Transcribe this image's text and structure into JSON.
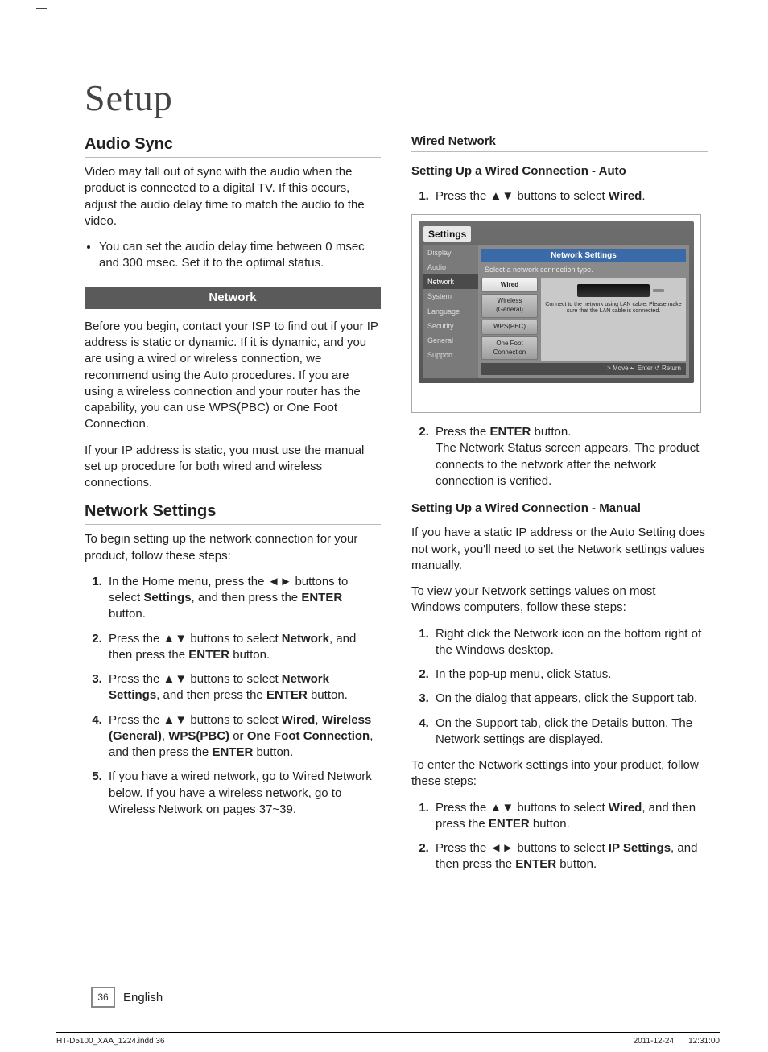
{
  "page_title": "Setup",
  "left": {
    "audio_sync": {
      "heading": "Audio Sync",
      "para": "Video may fall out of sync with the audio when the product is connected to a digital TV. If this occurs, adjust the audio delay time to match the audio to the video.",
      "bullet": "You can set the audio delay time between 0 msec and 300 msec. Set it to the optimal status."
    },
    "network_band": "Network",
    "network_intro1": "Before you begin, contact your ISP to find out if your IP address is static or dynamic. If it is dynamic, and you are using a wired or wireless connection, we recommend using the Auto procedures. If you are using a wireless connection and your router has the capability, you can use WPS(PBC) or One Foot Connection.",
    "network_intro2": "If your IP address is static, you must use the manual set up procedure for both wired and wireless connections.",
    "network_settings": {
      "heading": "Network Settings",
      "lead": "To begin setting up the network connection for your product, follow these steps:",
      "step1_a": "In the Home menu, press the ◄► buttons to select ",
      "step1_b1": "Settings",
      "step1_c": ", and then press the ",
      "step1_b2": "ENTER",
      "step1_d": " button.",
      "step2_a": "Press the ▲▼ buttons to select ",
      "step2_b1": "Network",
      "step2_c": ", and then press the ",
      "step2_b2": "ENTER",
      "step2_d": " button.",
      "step3_a": "Press the ▲▼ buttons to select ",
      "step3_b1": "Network Settings",
      "step3_c": ", and then press the ",
      "step3_b2": "ENTER",
      "step3_d": " button.",
      "step4_a": "Press the ▲▼ buttons to select ",
      "step4_b1": "Wired",
      "step4_s1": ", ",
      "step4_b2": "Wireless (General)",
      "step4_s2": ", ",
      "step4_b3": "WPS(PBC)",
      "step4_s3": " or ",
      "step4_b4": "One Foot Connection",
      "step4_c": ", and then press the ",
      "step4_b5": "ENTER",
      "step4_d": " button.",
      "step5": "If you have a wired network, go to Wired Network below. If you have a wireless network, go to Wireless Network on pages 37~39."
    }
  },
  "right": {
    "wired_heading": "Wired Network",
    "auto": {
      "sub": "Setting Up a Wired Connection - Auto",
      "step1_a": "Press the ▲▼ buttons to select ",
      "step1_b": "Wired",
      "step1_c": ".",
      "step2_a": "Press the ",
      "step2_b": "ENTER",
      "step2_c": " button.",
      "step2_p": "The Network Status screen appears. The product connects to the network after the network connection is verified."
    },
    "manual": {
      "sub": "Setting Up a Wired Connection - Manual",
      "p1": "If you have a static IP address or the Auto Setting does not work, you'll need to set the Network settings values manually.",
      "p2": "To view your Network settings values on most Windows computers, follow these steps:",
      "w1": "Right click the Network icon on the bottom right of the Windows desktop.",
      "w2": "In the pop-up menu, click Status.",
      "w3": "On the dialog that appears, click the Support tab.",
      "w4": "On the Support tab, click the Details button. The Network settings are displayed.",
      "p3": "To enter the Network settings into your product, follow these steps:",
      "s1_a": "Press the ▲▼ buttons to select ",
      "s1_b": "Wired",
      "s1_c": ", and then press the ",
      "s1_d": "ENTER",
      "s1_e": " button.",
      "s2_a": "Press the ◄► buttons to select ",
      "s2_b": "IP Settings",
      "s2_c": ", and then press the ",
      "s2_d": "ENTER",
      "s2_e": " button."
    }
  },
  "settings_widget": {
    "title": "Settings",
    "side": [
      "Display",
      "Audio",
      "Network",
      "System",
      "Language",
      "Security",
      "General",
      "Support"
    ],
    "header": "Network Settings",
    "subtitle": "Select a network connection type.",
    "options": [
      "Wired",
      "Wireless (General)",
      "WPS(PBC)",
      "One Foot Connection"
    ],
    "preview": "Connect to the network using LAN cable. Please make sure that the LAN cable is connected.",
    "footer": "> Move    ↵ Enter    ↺ Return"
  },
  "pagenum": "36",
  "language": "English",
  "footer_left": "HT-D5100_XAA_1224.indd   36",
  "footer_date": "2011-12-24",
  "footer_time": "12:31:00"
}
